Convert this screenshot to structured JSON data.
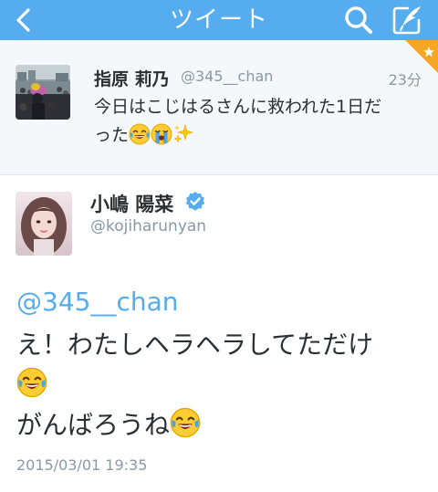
{
  "header": {
    "title": "ツイート",
    "back_icon": "chevron-left-icon",
    "search_icon": "search-icon",
    "compose_icon": "compose-tweet-icon",
    "bar_color": "#55acee"
  },
  "parent_tweet": {
    "name": "指原 莉乃",
    "handle": "@345__chan",
    "time": "23分",
    "text_line1": "今日はこじはるさんに救われた1日だ",
    "text_line2": "った",
    "emojis": [
      "face-with-tears-of-joy",
      "loudly-crying-face",
      "sparkles"
    ],
    "ribbon_color": "#f5a623"
  },
  "main_tweet": {
    "name": "小嶋 陽菜",
    "verified": true,
    "handle": "@kojiharunyan",
    "mention": "@345__chan",
    "text_line1": "え！わたしヘラヘラしてただけ",
    "text_line2": "",
    "text_line3": "がんばろうね",
    "emojis": [
      "face-with-tears-of-joy",
      "face-with-tears-of-joy"
    ],
    "timestamp": "2015/03/01 19:35",
    "accent_color": "#55acee"
  }
}
